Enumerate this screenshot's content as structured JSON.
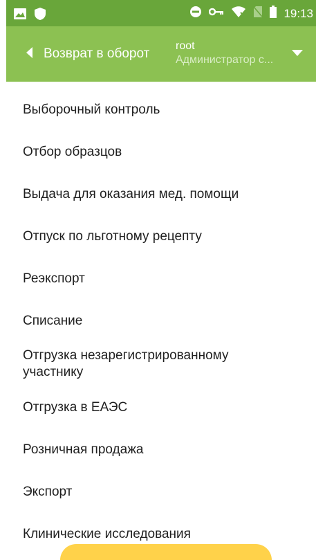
{
  "status_bar": {
    "time": "19:13",
    "left_icons": [
      "image-icon",
      "shield-icon"
    ],
    "right_icons": [
      "do-not-disturb-icon",
      "key-icon",
      "wifi-off-icon",
      "no-sim-icon",
      "battery-icon"
    ],
    "color": "#69a63a"
  },
  "app_bar": {
    "title": "Возврат в оборот",
    "user_name": "root",
    "user_role": "Администратор с...",
    "color": "#8cc152"
  },
  "menu": {
    "items": [
      {
        "label": "Выборочный контроль"
      },
      {
        "label": "Отбор образцов"
      },
      {
        "label": "Выдача для оказания мед. помощи"
      },
      {
        "label": "Отпуск по льготному рецепту"
      },
      {
        "label": "Реэкспорт"
      },
      {
        "label": "Списание"
      },
      {
        "label": "Отгрузка незарегистрированному участнику"
      },
      {
        "label": "Отгрузка в ЕАЭС"
      },
      {
        "label": "Розничная продажа"
      },
      {
        "label": "Экспорт"
      },
      {
        "label": "Клинические исследования"
      }
    ]
  },
  "bottom_button": {
    "color": "#ffd24a"
  }
}
